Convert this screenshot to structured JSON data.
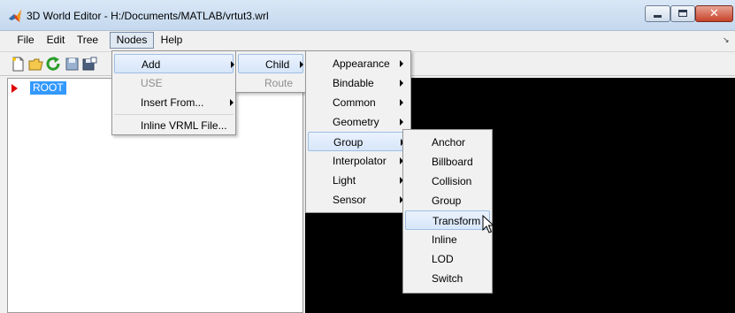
{
  "window": {
    "title": "3D World Editor - H:/Documents/MATLAB/vrtut3.wrl",
    "controls": {
      "minimize": "minimize",
      "maximize": "maximize",
      "close": "✕"
    }
  },
  "menubar": {
    "file": "File",
    "edit": "Edit",
    "tree": "Tree",
    "nodes": "Nodes",
    "help": "Help"
  },
  "toolbar": [
    "new-file-icon",
    "open-folder-icon",
    "refresh-icon",
    "save-icon",
    "save-as-icon"
  ],
  "tree": {
    "root_label": "ROOT"
  },
  "nodes_menu": {
    "add": "Add",
    "use": "USE",
    "insert_from": "Insert From...",
    "inline_vrml": "Inline VRML File..."
  },
  "add_menu": {
    "child": "Child",
    "route": "Route"
  },
  "child_menu": {
    "appearance": "Appearance",
    "bindable": "Bindable",
    "common": "Common",
    "geometry": "Geometry",
    "group": "Group",
    "interpolator": "Interpolator",
    "light": "Light",
    "sensor": "Sensor"
  },
  "group_menu": {
    "anchor": "Anchor",
    "billboard": "Billboard",
    "collision": "Collision",
    "group": "Group",
    "transform": "Transform",
    "inline": "Inline",
    "lod": "LOD",
    "switch": "Switch"
  },
  "colors": {
    "selection": "#3399ff",
    "root_arrow": "#e00000",
    "viewer_bg": "#000000"
  }
}
